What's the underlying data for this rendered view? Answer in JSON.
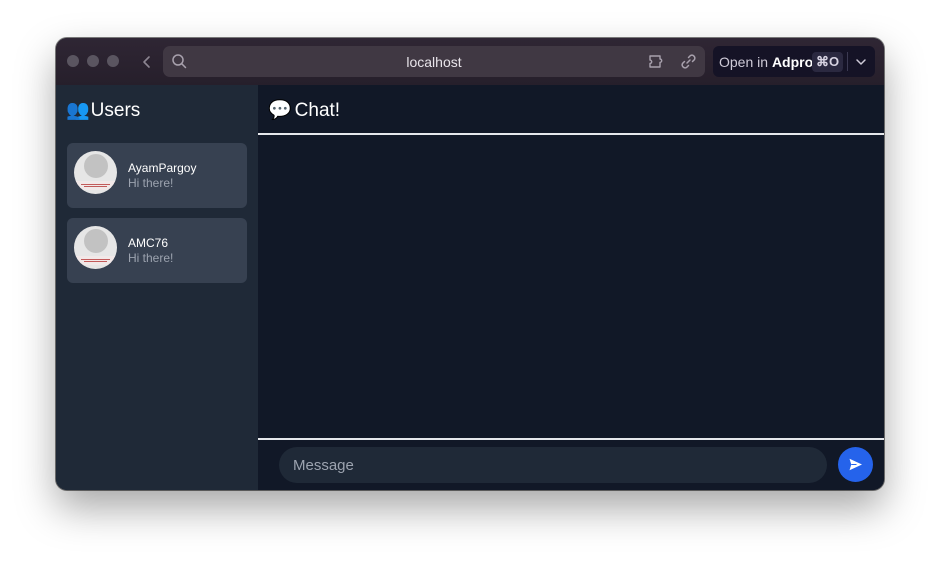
{
  "browser": {
    "url": "localhost",
    "open_in": {
      "prefix": "Open in",
      "app": "Adpro",
      "shortcut": "⌘O"
    }
  },
  "sidebar": {
    "emoji": "👥",
    "title": "Users",
    "users": [
      {
        "name": "AyamPargoy",
        "last_message": "Hi there!"
      },
      {
        "name": "AMC76",
        "last_message": "Hi there!"
      }
    ]
  },
  "chat": {
    "emoji": "💬",
    "title": "Chat!",
    "input_placeholder": "Message"
  },
  "colors": {
    "window_bg": "#111827",
    "sidebar_bg": "#1f2937",
    "card_bg": "#374151",
    "accent": "#2563eb"
  }
}
